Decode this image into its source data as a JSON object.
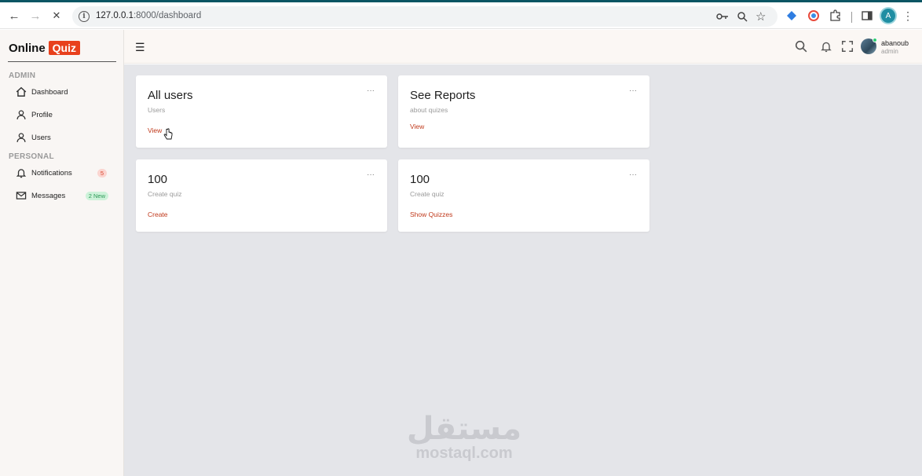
{
  "browser": {
    "url_host": "127.0.0.1",
    "url_path": ":8000/dashboard",
    "profile_initial": "A",
    "nav_back": "←",
    "nav_forward": "→",
    "nav_stop": "✕"
  },
  "brand": {
    "name": "Online",
    "badge": "Quiz",
    "accent_color": "#e8401c"
  },
  "sidebar": {
    "admin_section": "ADMIN",
    "personal_section": "PERSONAL",
    "items": [
      {
        "label": "Dashboard",
        "icon": "home-icon"
      },
      {
        "label": "Profile",
        "icon": "user-icon"
      },
      {
        "label": "Users",
        "icon": "user-icon"
      },
      {
        "label": "Notifications",
        "icon": "bell-icon",
        "badge": "5"
      },
      {
        "label": "Messages",
        "icon": "mail-icon",
        "badge": "2 New"
      }
    ]
  },
  "header": {
    "menu_icon": "☰",
    "user_name": "abanoub",
    "user_role": "admin"
  },
  "cards": [
    {
      "title": "All users",
      "subtitle": "Users",
      "link": "View",
      "menu": "···"
    },
    {
      "title": "See Reports",
      "subtitle": "about quizes",
      "link": "View",
      "menu": "···"
    },
    {
      "title": "100",
      "subtitle": "Create quiz",
      "link": "Create",
      "menu": "···"
    },
    {
      "title": "100",
      "subtitle": "Create quiz",
      "link": "Show Quizzes",
      "menu": "···"
    }
  ],
  "watermark": {
    "arabic": "مستقل",
    "latin": "mostaql.com"
  }
}
